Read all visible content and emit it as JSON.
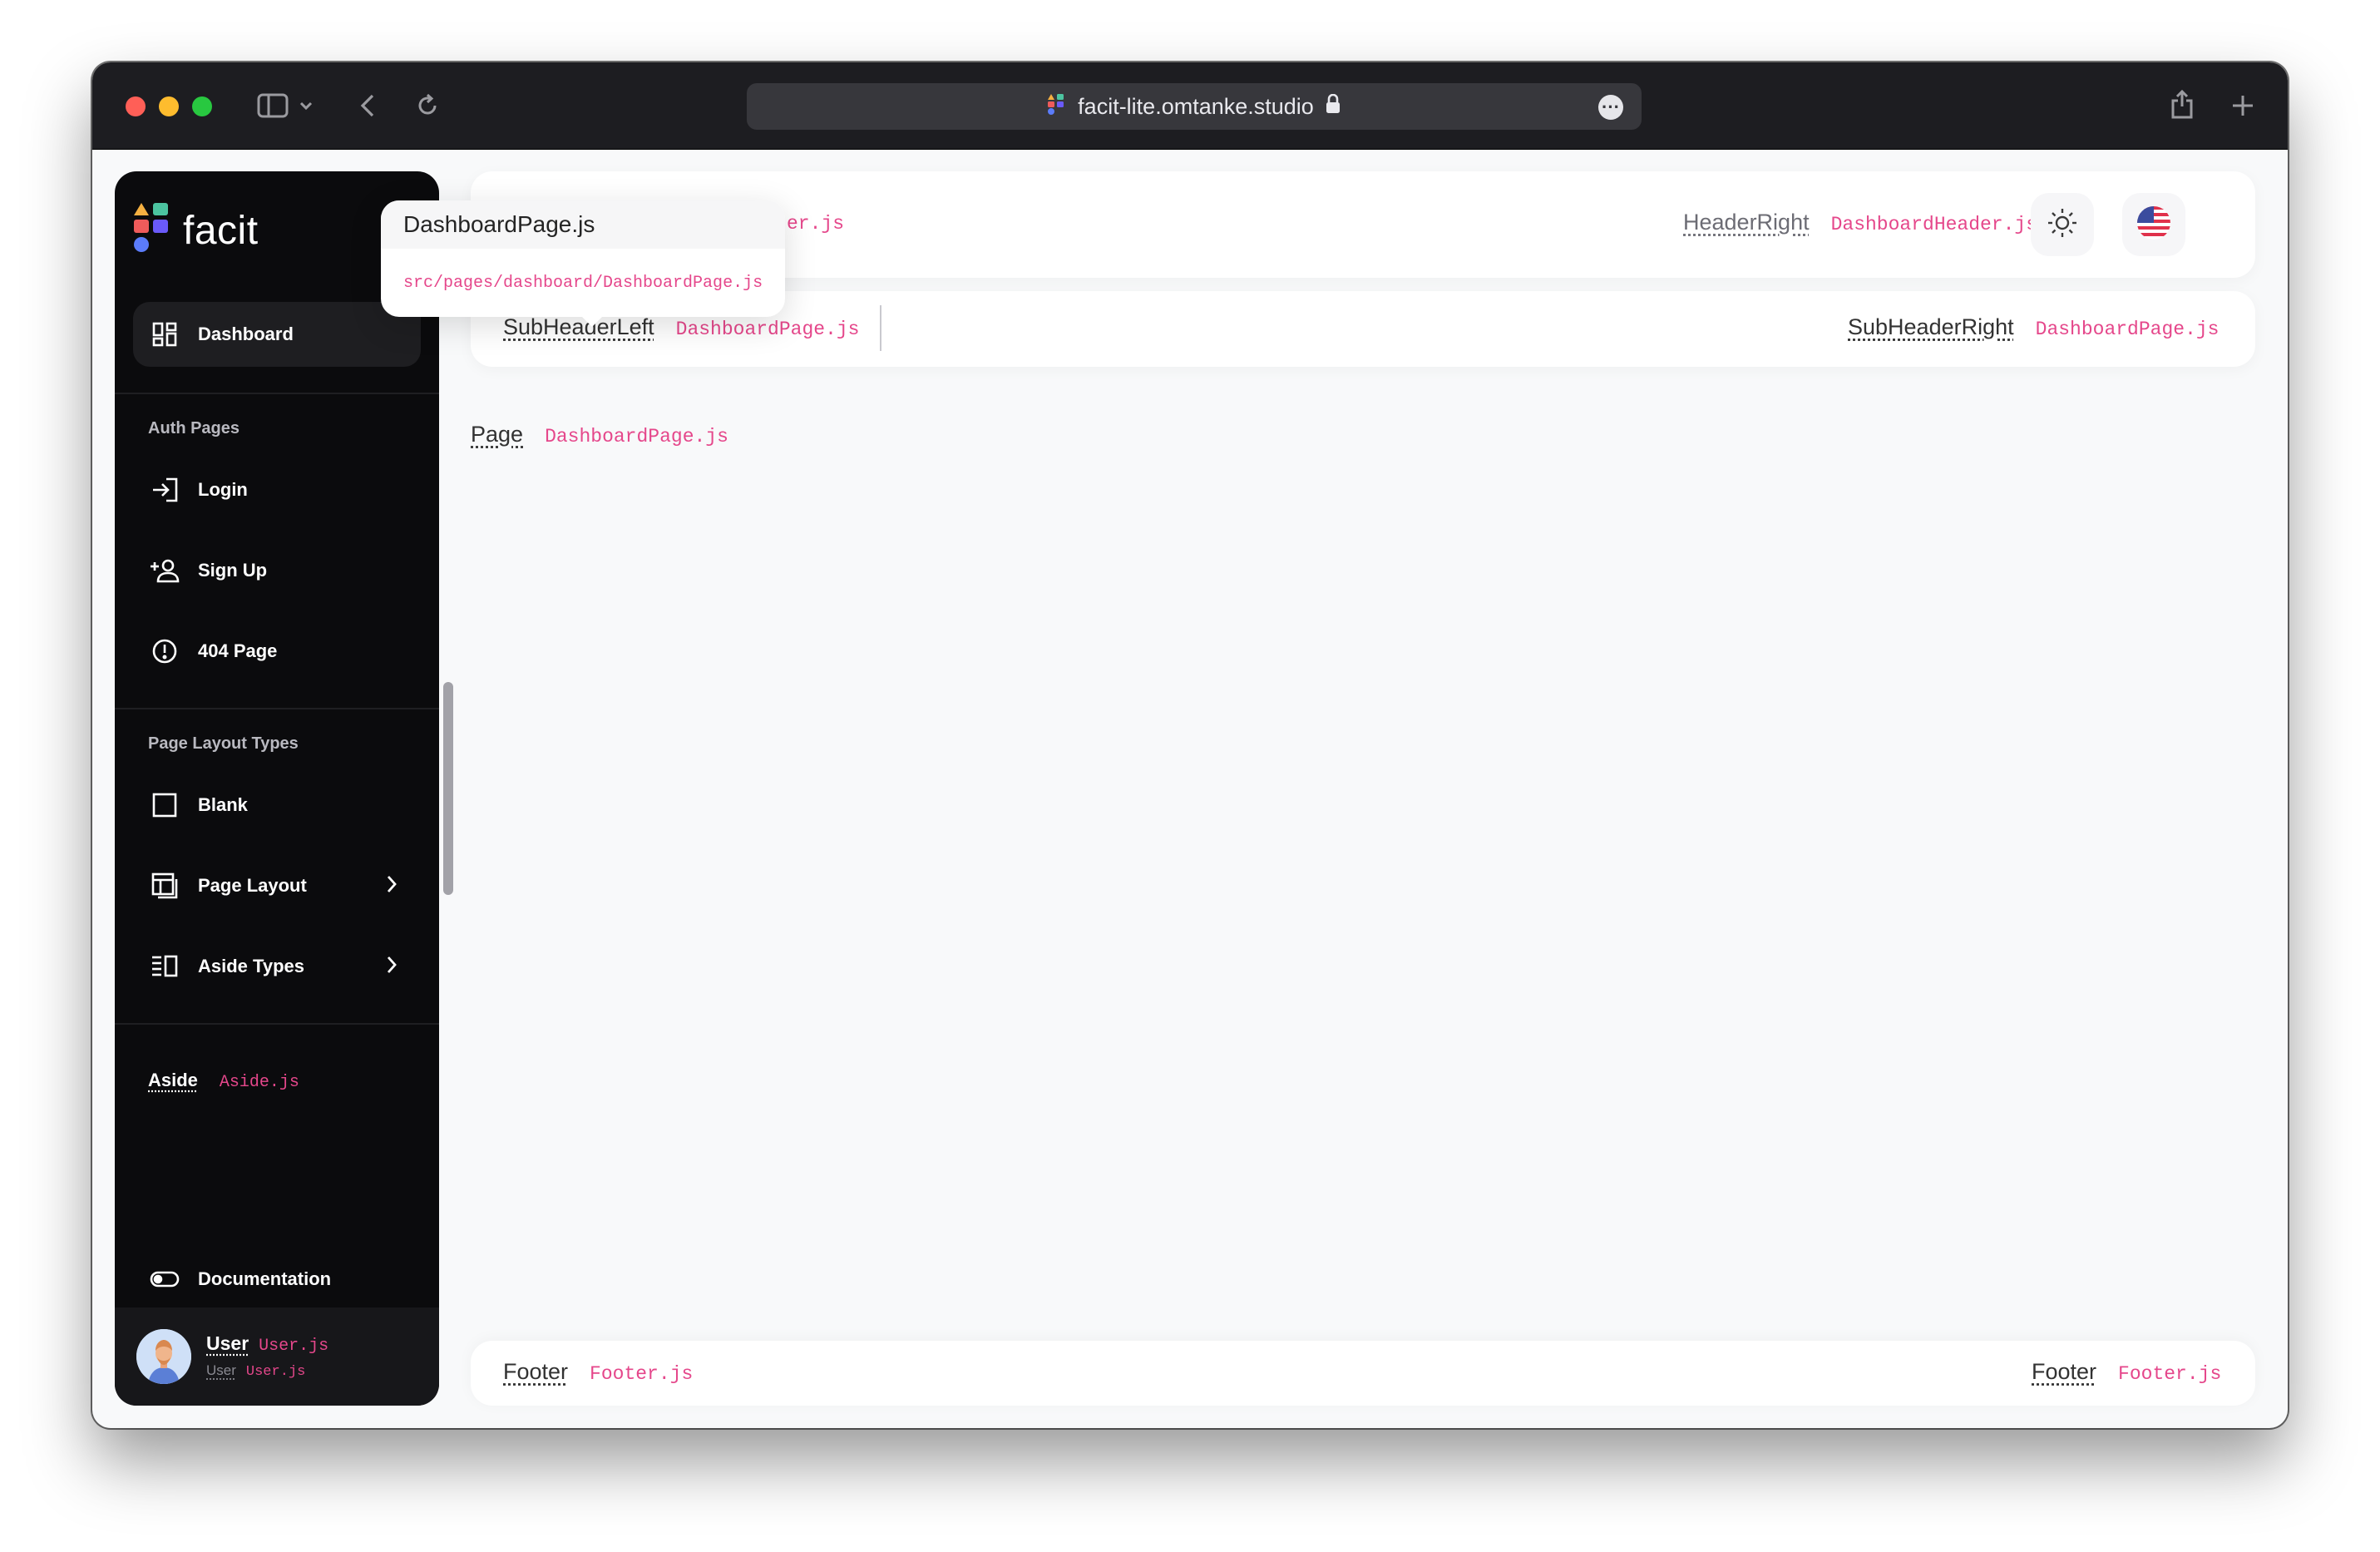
{
  "browser": {
    "url": "facit-lite.omtanke.studio"
  },
  "aside": {
    "brand": "facit",
    "dashboard_label": "Dashboard",
    "auth_section": "Auth Pages",
    "auth_items": [
      {
        "label": "Login"
      },
      {
        "label": "Sign Up"
      },
      {
        "label": "404 Page"
      }
    ],
    "layout_section": "Page Layout Types",
    "layout_items": [
      {
        "label": "Blank"
      },
      {
        "label": "Page Layout"
      },
      {
        "label": "Aside Types"
      }
    ],
    "aside_label": "Aside",
    "aside_file": "Aside.js",
    "documentation_label": "Documentation",
    "user": {
      "name": "User",
      "name_file": "User.js",
      "role": "User",
      "role_file": "User.js"
    }
  },
  "header": {
    "left_file_partial": "er.js",
    "right_label": "HeaderRight",
    "right_file": "DashboardHeader.js"
  },
  "subheader": {
    "left_label": "SubHeaderLeft",
    "left_file": "DashboardPage.js",
    "right_label": "SubHeaderRight",
    "right_file": "DashboardPage.js"
  },
  "page": {
    "label": "Page",
    "file": "DashboardPage.js"
  },
  "footer": {
    "left_label": "Footer",
    "left_file": "Footer.js",
    "right_label": "Footer",
    "right_file": "Footer.js"
  },
  "popover": {
    "title": "DashboardPage.js",
    "path": "src/pages/dashboard/DashboardPage.js"
  }
}
